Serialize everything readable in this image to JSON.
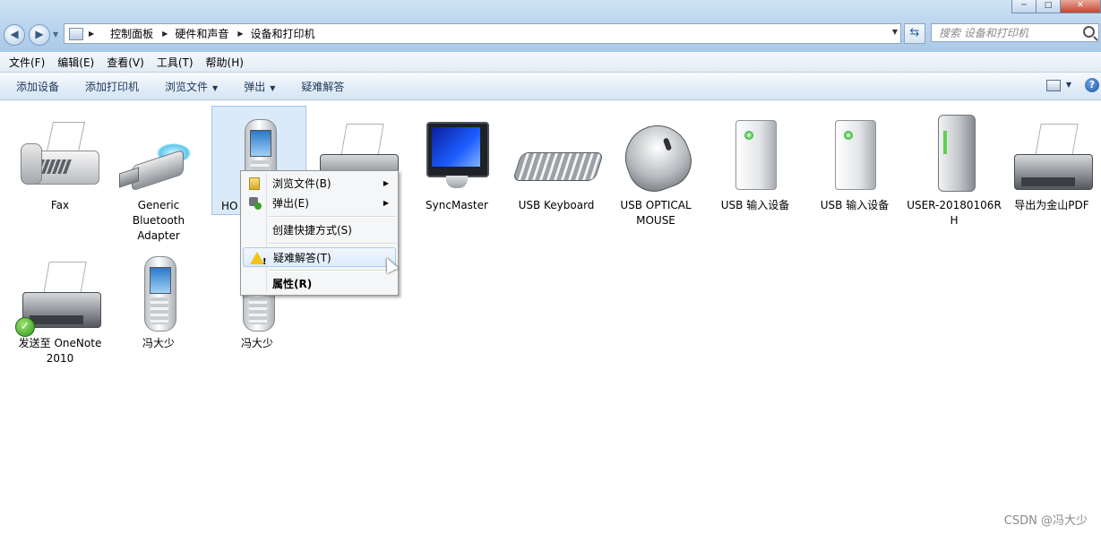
{
  "window": {
    "controls": {
      "minimize": "─",
      "maximize": "□",
      "close": "✕"
    }
  },
  "address_bar": {
    "breadcrumbs": [
      "控制面板",
      "硬件和声音",
      "设备和打印机"
    ],
    "search_placeholder": "搜索 设备和打印机"
  },
  "menu_bar": {
    "items": [
      "文件(F)",
      "编辑(E)",
      "查看(V)",
      "工具(T)",
      "帮助(H)"
    ]
  },
  "command_bar": {
    "items": [
      {
        "label": "添加设备",
        "dropdown": false
      },
      {
        "label": "添加打印机",
        "dropdown": false
      },
      {
        "label": "浏览文件",
        "dropdown": true
      },
      {
        "label": "弹出",
        "dropdown": true
      },
      {
        "label": "疑难解答",
        "dropdown": false
      }
    ],
    "help": "?"
  },
  "devices": [
    {
      "label": "Fax",
      "icon": "fax-icon"
    },
    {
      "label": "Generic Bluetooth Adapter",
      "icon": "bluetooth-adapter-icon"
    },
    {
      "label": "HO",
      "icon": "mobile-phone-icon",
      "selected": true
    },
    {
      "label": "",
      "icon": "printer-icon"
    },
    {
      "label": "SyncMaster",
      "icon": "monitor-icon"
    },
    {
      "label": "USB Keyboard",
      "icon": "keyboard-icon"
    },
    {
      "label": "USB OPTICAL MOUSE",
      "icon": "mouse-icon"
    },
    {
      "label": "USB 输入设备",
      "icon": "input-device-icon"
    },
    {
      "label": "USB 输入设备",
      "icon": "input-device-icon"
    },
    {
      "label": "USER-20180106RH",
      "icon": "computer-icon"
    },
    {
      "label": "导出为金山PDF",
      "icon": "printer-icon"
    },
    {
      "label": "发送至 OneNote 2010",
      "icon": "printer-icon",
      "default": true
    },
    {
      "label": "冯大少",
      "icon": "mobile-phone-icon"
    },
    {
      "label": "冯大少",
      "icon": "mobile-phone-icon"
    }
  ],
  "context_menu": {
    "items": [
      {
        "label": "浏览文件(B)",
        "submenu": true,
        "icon": "folder-icon"
      },
      {
        "label": "弹出(E)",
        "submenu": true,
        "icon": "eject-icon"
      },
      {
        "label": "创建快捷方式(S)",
        "submenu": false
      },
      {
        "label": "疑难解答(T)",
        "submenu": false,
        "icon": "warning-icon",
        "hovered": true
      },
      {
        "label": "属性(R)",
        "submenu": false,
        "bold": true
      }
    ]
  },
  "watermark": "CSDN @冯大少"
}
